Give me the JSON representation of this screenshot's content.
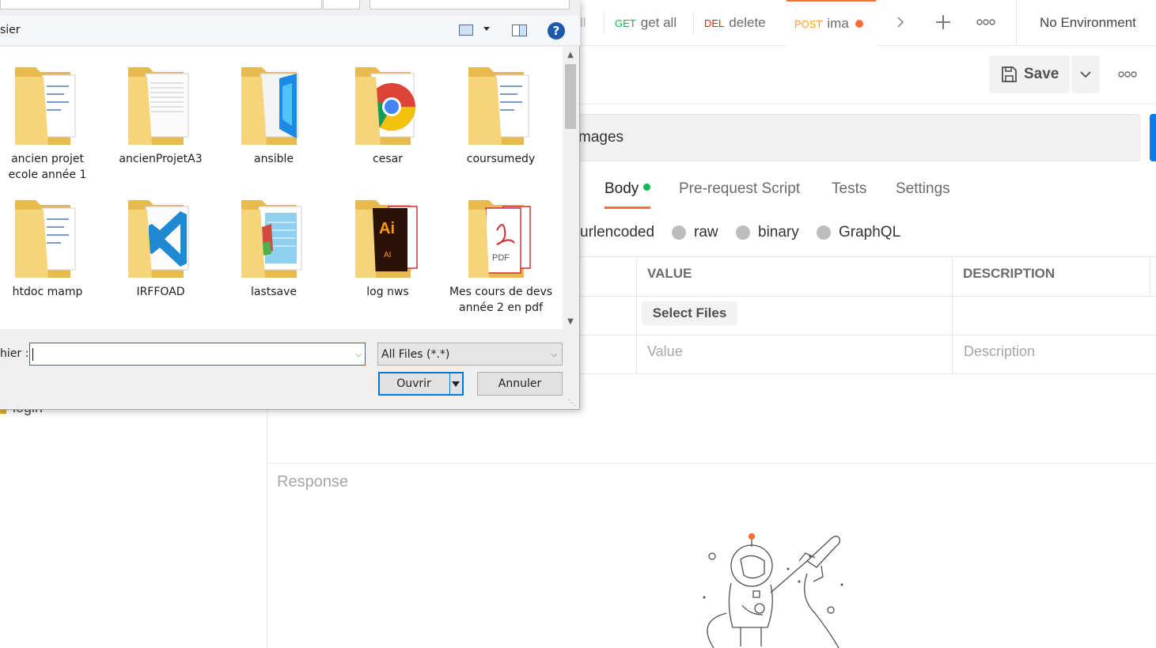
{
  "postman": {
    "tabs": [
      {
        "method": "",
        "name": "ll",
        "method_color": "#6b6b6b"
      },
      {
        "method": "GET",
        "name": "get all",
        "method_color": "#0cbb52"
      },
      {
        "method": "DEL",
        "name": "delete",
        "method_color": "#eb2013"
      },
      {
        "method": "POST",
        "name": "ima",
        "method_color": "#ff9e1b"
      }
    ],
    "environment": "No Environment",
    "save_label": "Save",
    "url_text": "mages",
    "subtabs": [
      "Body",
      "Pre-request Script",
      "Tests",
      "Settings"
    ],
    "body_modes": [
      "urlencoded",
      "raw",
      "binary",
      "GraphQL"
    ],
    "table_headers": [
      "VALUE",
      "DESCRIPTION"
    ],
    "select_files_label": "Select Files",
    "value_placeholder": "Value",
    "description_placeholder": "Description",
    "sidebar_item": "login",
    "response_label": "Response"
  },
  "dialog": {
    "organize_label": "sier",
    "help_label": "?",
    "folders": [
      {
        "label": "ancien projet ecole année 1",
        "icon": "folder-docs-icon"
      },
      {
        "label": "ancienProjetA3",
        "icon": "folder-text-icon"
      },
      {
        "label": "ansible",
        "icon": "folder-blue-icon"
      },
      {
        "label": "cesar",
        "icon": "folder-chrome-icon"
      },
      {
        "label": "coursumedy",
        "icon": "folder-docs-icon"
      },
      {
        "label": "htdoc mamp",
        "icon": "folder-docs-icon"
      },
      {
        "label": "IRFFOAD",
        "icon": "folder-vscode-icon"
      },
      {
        "label": "lastsave",
        "icon": "folder-notepad-icon"
      },
      {
        "label": "log nws",
        "icon": "folder-illustrator-icon"
      },
      {
        "label": "Mes cours de devs année 2 en pdf",
        "icon": "folder-pdf-icon"
      }
    ],
    "filename_label": "hier :",
    "filename_value": "",
    "filter_value": "All Files (*.*)",
    "open_label": "Ouvrir",
    "cancel_label": "Annuler"
  }
}
